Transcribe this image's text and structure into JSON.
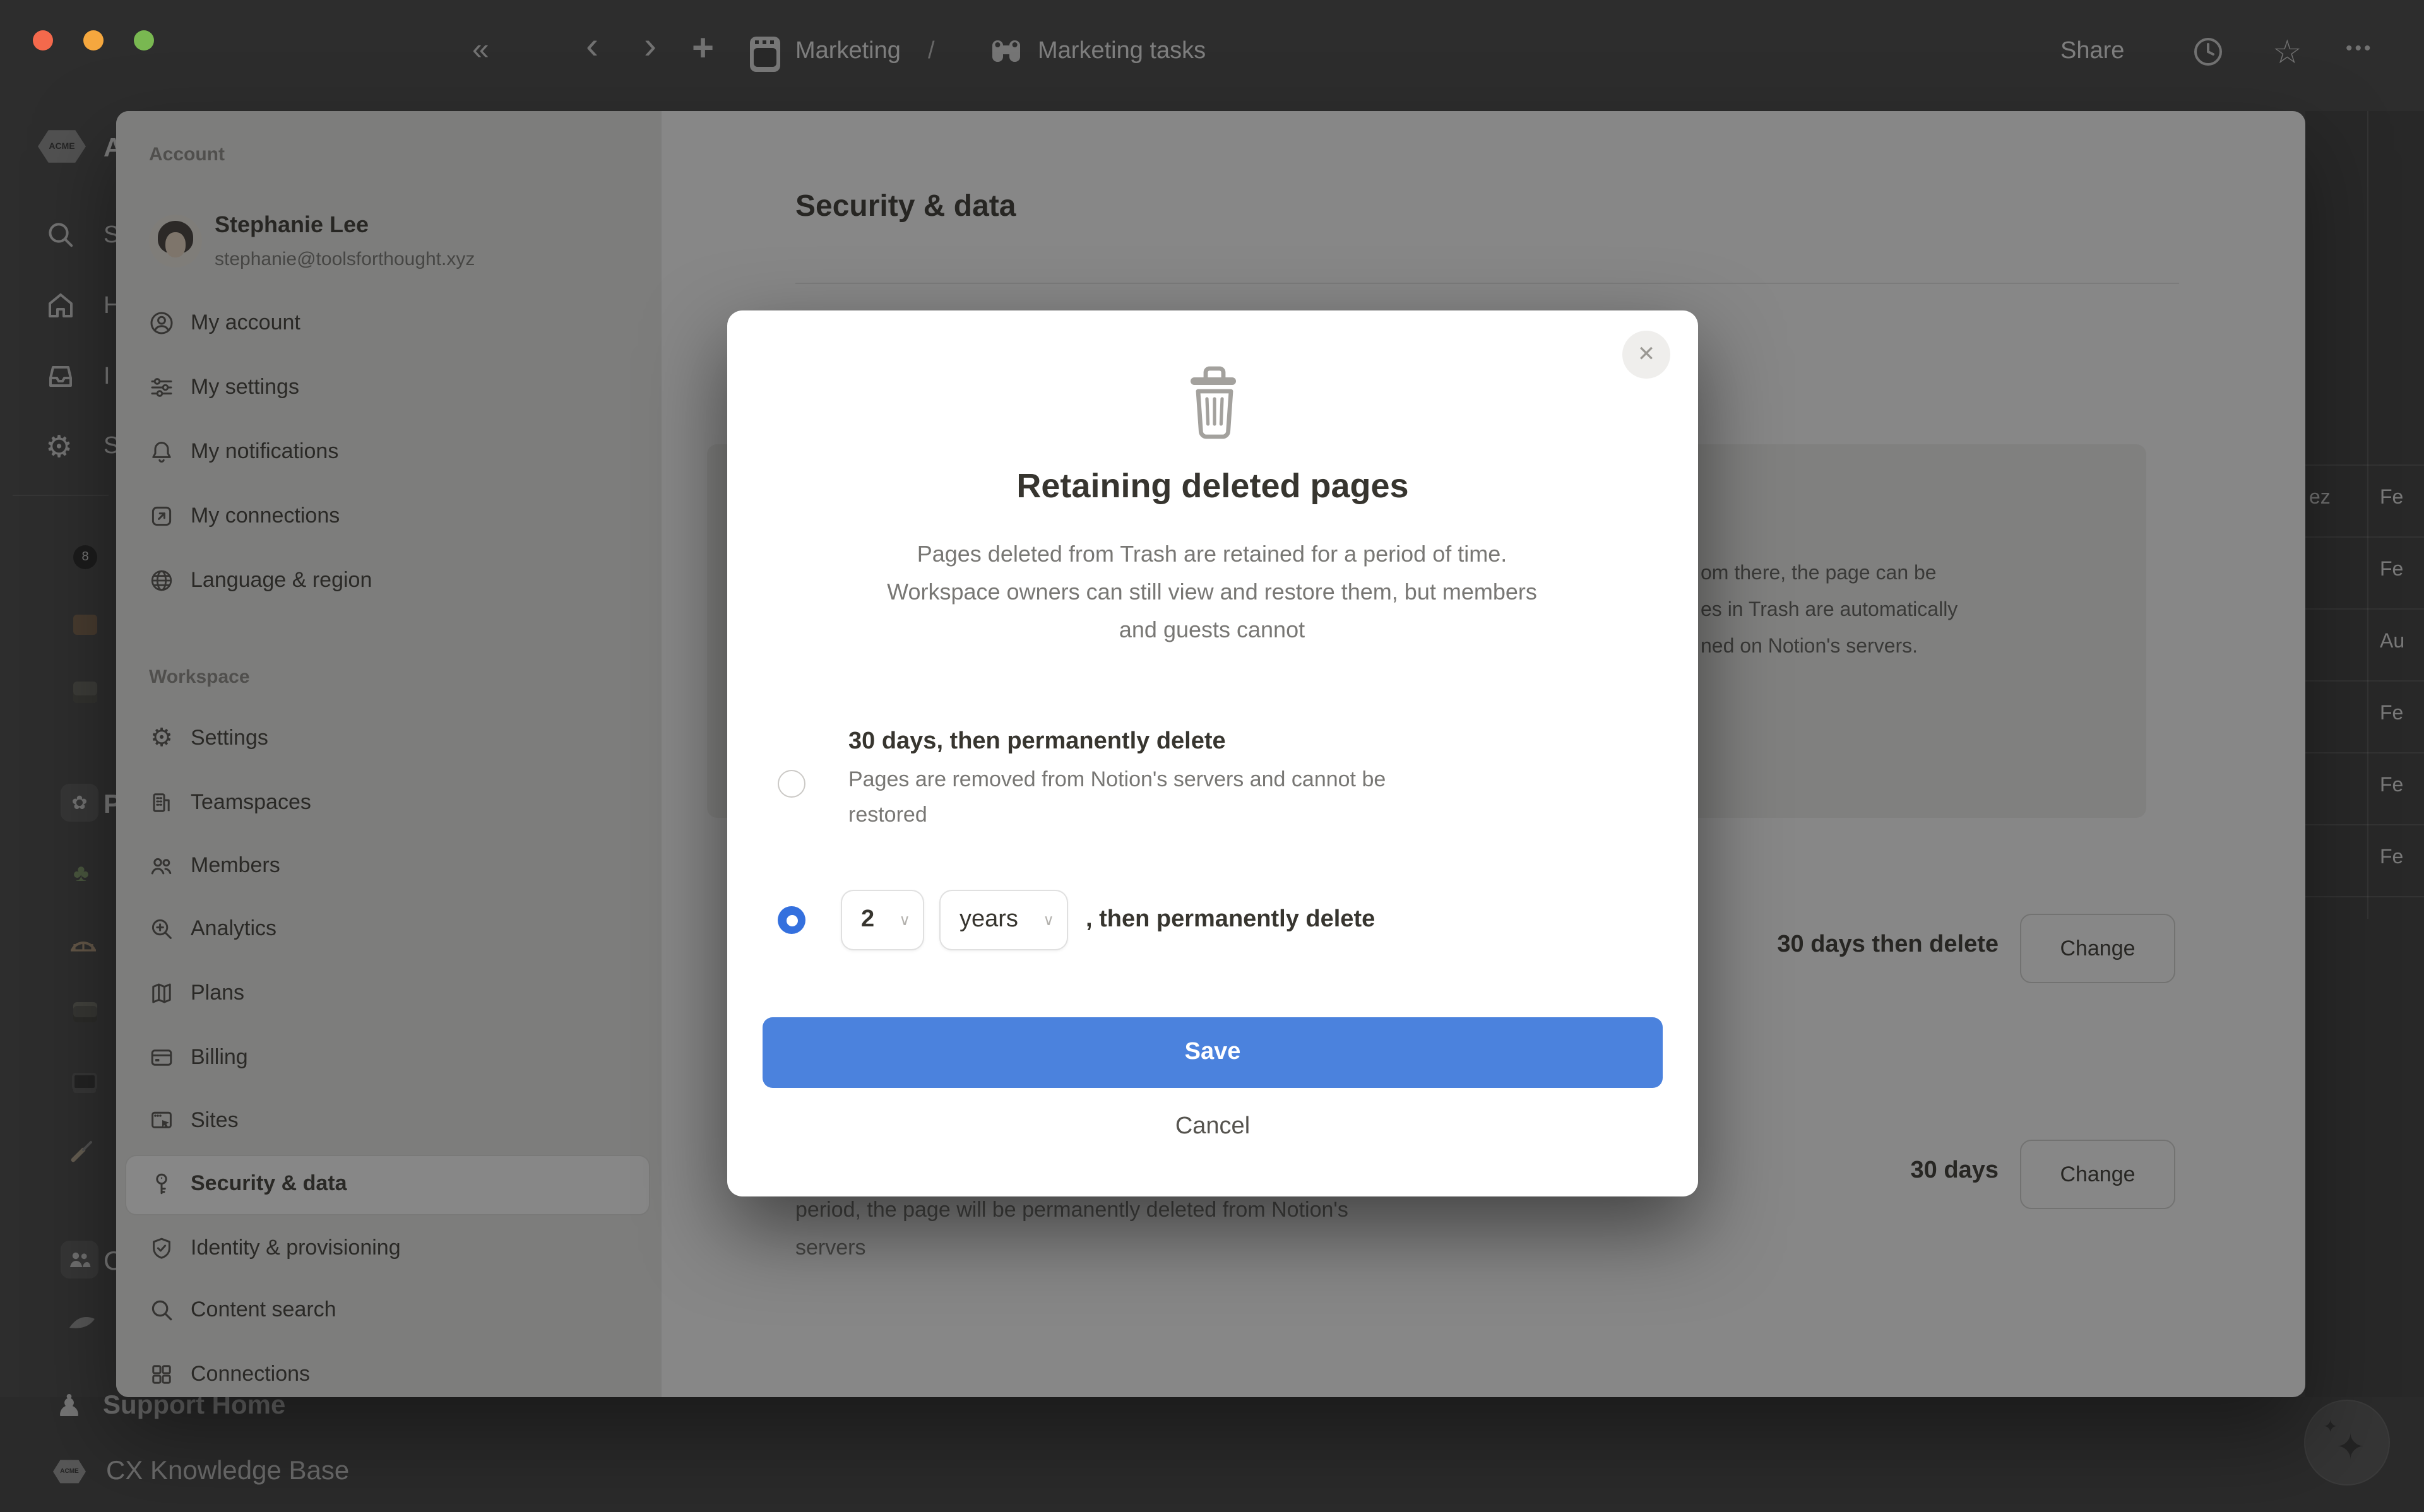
{
  "window": {
    "controls": [
      {
        "name": "close",
        "color": "#f4694c"
      },
      {
        "name": "minimize",
        "color": "#f5a73e"
      },
      {
        "name": "zoom",
        "color": "#79b851"
      }
    ]
  },
  "topbar": {
    "collapse_glyph": "«",
    "back_glyph": "‹",
    "forward_glyph": "›",
    "plus_glyph": "+",
    "breadcrumb": {
      "root": "Marketing",
      "separator": "/",
      "child": "Marketing tasks"
    },
    "share_label": "Share",
    "star_glyph": "☆",
    "more_glyph": "•••"
  },
  "app_sidebar": {
    "workspace_fragment": "A",
    "nav_fragments": {
      "search": "S",
      "home": "H",
      "inbox": "I",
      "settings": "S"
    },
    "page_fragments": {
      "teamspace": "P",
      "people": "C"
    },
    "eight_ball_glyph": "8",
    "pawn_glyph": "♟",
    "teamspace_glyph": "✿",
    "plant_glyph": "♣",
    "acme_text": "ACME",
    "footer_items": [
      {
        "icon": "pawn-icon",
        "label": "Support Home"
      },
      {
        "icon": "acme-logo",
        "label": "CX Knowledge Base"
      }
    ]
  },
  "background_table": {
    "row_fragment": "ez",
    "cells": [
      "Fe",
      "Fe",
      "Au",
      "Fe",
      "Fe",
      "Fe"
    ]
  },
  "settings": {
    "account": {
      "section_label": "Account",
      "name": "Stephanie Lee",
      "email": "stephanie@toolsforthought.xyz",
      "items": [
        {
          "icon": "person-circle-icon",
          "label": "My account"
        },
        {
          "icon": "sliders-icon",
          "label": "My settings"
        },
        {
          "icon": "bell-icon",
          "label": "My notifications"
        },
        {
          "icon": "arrow-out-box-icon",
          "label": "My connections"
        },
        {
          "icon": "globe-icon",
          "label": "Language & region"
        }
      ]
    },
    "workspace": {
      "section_label": "Workspace",
      "items": [
        {
          "icon": "gear-icon",
          "label": "Settings"
        },
        {
          "icon": "building-icon",
          "label": "Teamspaces"
        },
        {
          "icon": "members-icon",
          "label": "Members"
        },
        {
          "icon": "analytics-icon",
          "label": "Analytics"
        },
        {
          "icon": "map-icon",
          "label": "Plans"
        },
        {
          "icon": "credit-card-icon",
          "label": "Billing"
        },
        {
          "icon": "browser-icon",
          "label": "Sites"
        },
        {
          "icon": "key-icon",
          "label": "Security & data",
          "active": true
        },
        {
          "icon": "shield-check-icon",
          "label": "Identity & provisioning"
        },
        {
          "icon": "search-icon",
          "label": "Content search"
        },
        {
          "icon": "grid-icon",
          "label": "Connections"
        }
      ]
    },
    "content": {
      "title": "Security & data",
      "callout_visible_lines": [
        "om there, the page can be",
        "es in Trash are automatically",
        "ned on Notion's servers."
      ],
      "rows": [
        {
          "value": "30 days then delete",
          "button": "Change"
        },
        {
          "value": "30 days",
          "button": "Change"
        }
      ],
      "footnote_line1": "period, the page will be permanently deleted from Notion's",
      "footnote_line2": "servers"
    }
  },
  "modal": {
    "icon": "trash-icon",
    "close_glyph": "✕",
    "title": "Retaining deleted pages",
    "description": "Pages deleted from Trash are retained for a period of time. Workspace owners can still view and restore them, but members and guests cannot",
    "options": [
      {
        "label": "30 days, then permanently delete",
        "sublabel": "Pages are removed from Notion's servers and cannot be restored",
        "selected": false
      },
      {
        "duration_value": "2",
        "duration_unit": "years",
        "suffix": ", then permanently delete",
        "selected": true
      }
    ],
    "select_chevron": "∨",
    "save_label": "Save",
    "cancel_label": "Cancel",
    "colors": {
      "save_blue": "#4b82dd",
      "radio_blue": "#3470de"
    }
  },
  "ai_button": {
    "icon": "sparkles-icon",
    "glyph_large": "✦",
    "glyph_small": "✦"
  }
}
